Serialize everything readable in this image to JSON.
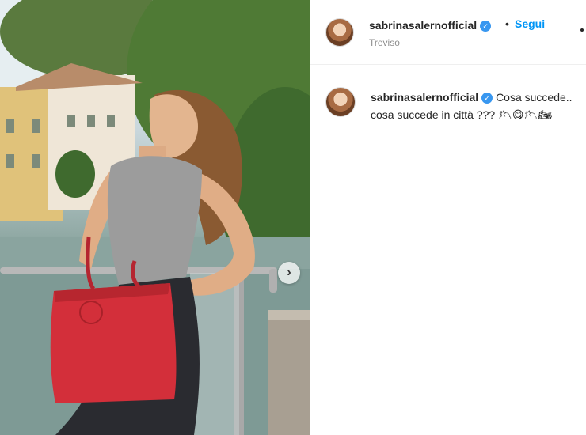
{
  "post": {
    "author": "sabrinasalernofficial",
    "location": "Treviso",
    "follow_label": "Segui",
    "separator": "•",
    "verified_mark": "✓",
    "next_arrow": "›",
    "caption_line1": "Cosa succede..",
    "caption_line2": "cosa succede in città ??? 🌥😋🌥🏍"
  },
  "icons": {
    "verified": "verified-badge-icon",
    "next": "chevron-right-icon",
    "more": "more-options-icon"
  },
  "colors": {
    "accent": "#0095f6",
    "verified": "#3897f0",
    "bag": "#d32f3a"
  }
}
